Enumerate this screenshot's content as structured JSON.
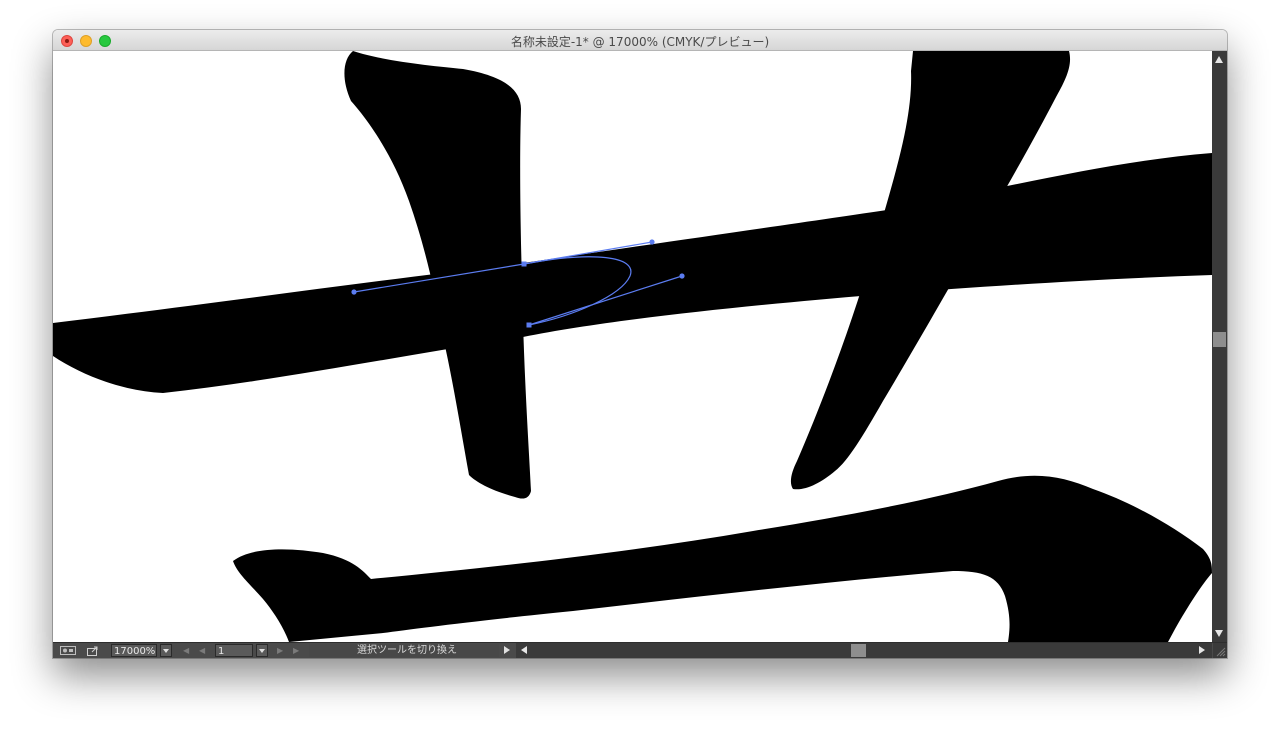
{
  "window": {
    "title": "名称未設定-1* @ 17000% (CMYK/プレビュー)"
  },
  "statusbar": {
    "zoom_value": "17000%",
    "page_value": "1",
    "status_text": "選択ツールを切り換え",
    "icons": {
      "artboard": "artboard-navigation-icon",
      "share": "share-icon"
    }
  },
  "canvas": {
    "fill_color": "#000000",
    "path_color": "#5b7cf0",
    "background": "#ffffff"
  }
}
